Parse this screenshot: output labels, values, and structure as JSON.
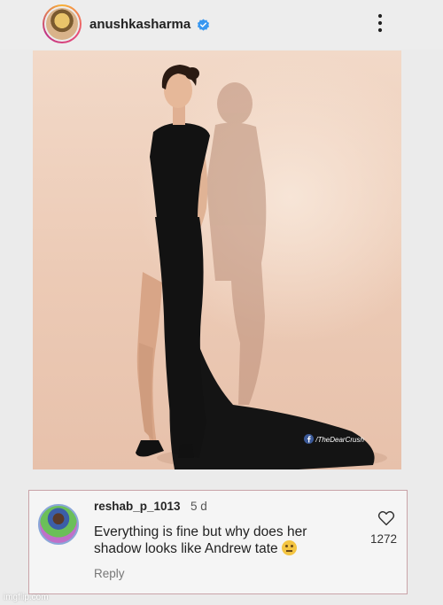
{
  "header": {
    "username": "anushkasharma",
    "verified_icon": "verified-badge-icon",
    "more_icon": "more-options-icon"
  },
  "post": {
    "photo_icon": "post-photo",
    "watermark": "/TheDearCrush"
  },
  "comment": {
    "username": "reshab_p_1013",
    "time": "5 d",
    "text": "Everything is fine but why does her shadow looks like Andrew tate",
    "emoji_icon": "thinking-face-icon",
    "reply_label": "Reply",
    "like_icon": "heart-icon",
    "likes": "1272"
  },
  "footer": {
    "watermark": "imgflip.com"
  },
  "colors": {
    "verified": "#3897f0",
    "comment_border": "#c9a3a8",
    "background": "#ebebeb"
  }
}
